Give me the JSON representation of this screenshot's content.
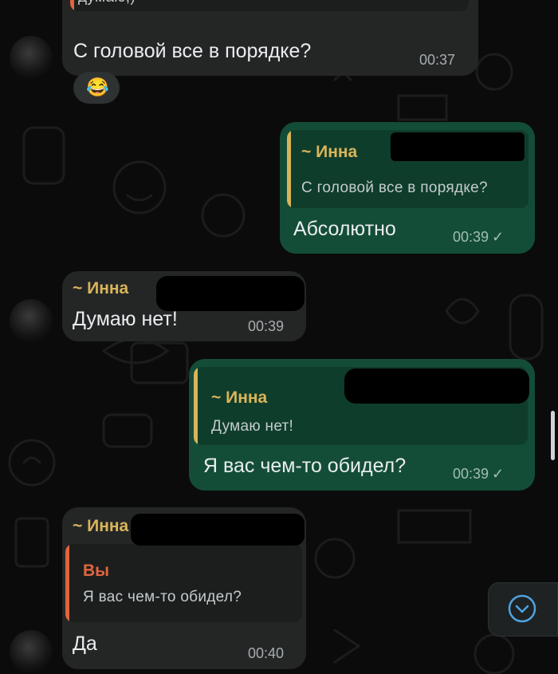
{
  "messages": {
    "m0": {
      "text_fragment": "думаю;)"
    },
    "m1": {
      "text": "С головой все в порядке?",
      "time": "00:37"
    },
    "reaction": {
      "emoji": "😂"
    },
    "m2": {
      "quote_name": "~ Инна",
      "quote_text": "С головой все в порядке?",
      "text": "Абсолютно",
      "time": "00:39",
      "status": "✓"
    },
    "m3": {
      "sender": "~ Инна",
      "text": "Думаю нет!",
      "time": "00:39"
    },
    "m4": {
      "quote_name": "~ Инна",
      "quote_text": "Думаю нет!",
      "text": "Я вас чем-то обидел?",
      "time": "00:39",
      "status": "✓"
    },
    "m5": {
      "sender": "~ Инна",
      "quote_name": "Вы",
      "quote_text": "Я вас чем-то обидел?",
      "text": "Да",
      "time": "00:40"
    }
  },
  "icons": {
    "scroll_down": "chevron-down-circle-icon",
    "sent": "check-icon",
    "avatar": "avatar"
  },
  "colors": {
    "background": "#0b0b0b",
    "incoming_bubble": "#242626",
    "outgoing_bubble": "#144d37",
    "quote_bar_incoming_sender": "#d9b45a",
    "quote_bar_self": "#e0653f",
    "accent_blue": "#4fa3e0"
  }
}
